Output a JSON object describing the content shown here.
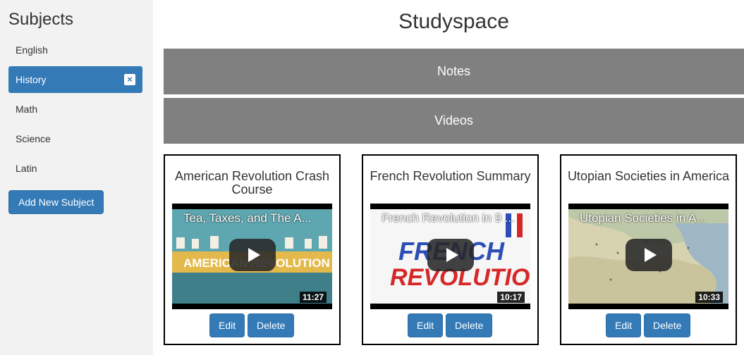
{
  "sidebar": {
    "title": "Subjects",
    "subjects": [
      {
        "label": "English"
      },
      {
        "label": "History",
        "active": true
      },
      {
        "label": "Math"
      },
      {
        "label": "Science"
      },
      {
        "label": "Latin"
      }
    ],
    "close_glyph": "×",
    "add_label": "Add New Subject",
    "active_color": "#337ab7"
  },
  "app_title": "Studyspace",
  "sections": {
    "notes_label": "Notes",
    "videos_label": "Videos",
    "bar_color": "#808080"
  },
  "videos": [
    {
      "title": "American Revolution Crash Course",
      "video_title": "Tea, Taxes, and The A...",
      "duration": "11:27",
      "thumbnail_text": "AMERICAN REVOLUTION"
    },
    {
      "title": "French Revolution Summary",
      "video_title": "French Revolution in 9 ...",
      "duration": "10:17",
      "thumbnail_text": "THE FRENCH REVOLUTION"
    },
    {
      "title": "Utopian Societies in America",
      "video_title": "Utopian Societies in A...",
      "duration": "10:33",
      "thumbnail_text": ""
    }
  ],
  "card_buttons": {
    "edit_label": "Edit",
    "delete_label": "Delete"
  },
  "icons": {
    "play": "play-icon",
    "close": "close-icon"
  }
}
